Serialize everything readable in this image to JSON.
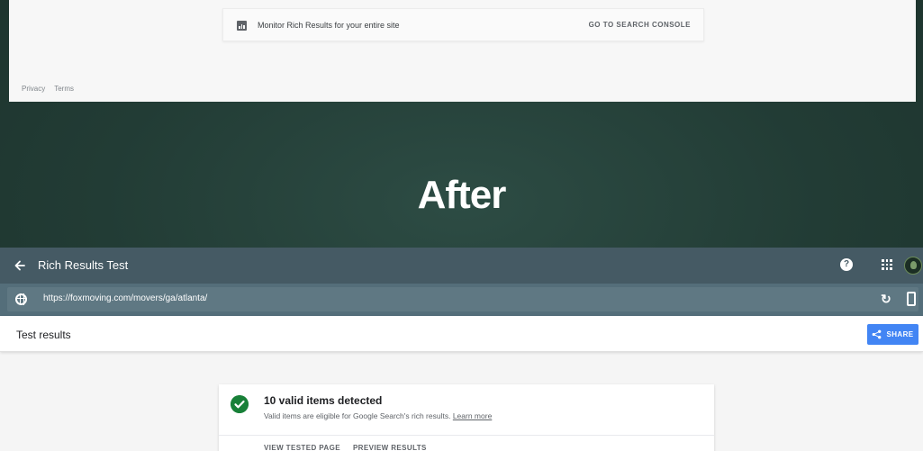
{
  "before": {
    "console_card_text": "Monitor Rich Results for your entire site",
    "console_link": "GO TO SEARCH CONSOLE",
    "footer": [
      "Privacy",
      "Terms"
    ]
  },
  "heading": "After",
  "after": {
    "app_title": "Rich Results Test",
    "url": "https://foxmoving.com/movers/ga/atlanta/",
    "results_title": "Test results",
    "share_label": "SHARE",
    "valid_title": "10 valid items detected",
    "valid_desc": "Valid items are eligible for Google Search's rich results.",
    "learn_more": "Learn more",
    "actions": [
      "VIEW TESTED PAGE",
      "PREVIEW RESULTS"
    ],
    "help_glyph": "?",
    "reload_glyph": "↻"
  },
  "colors": {
    "background": "#24413a",
    "topbar": "#455a64",
    "urlbar": "#546e7a",
    "accent": "#4285f4",
    "success": "#188038"
  },
  "icons": [
    "console-chart-icon",
    "back-arrow-icon",
    "help-icon",
    "apps-grid-icon",
    "globe-icon",
    "reload-icon",
    "device-icon",
    "share-icon",
    "check-circle-icon"
  ]
}
